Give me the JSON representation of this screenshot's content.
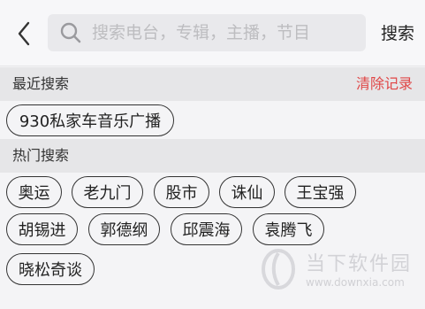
{
  "search": {
    "placeholder": "搜索电台，专辑，主播，节目",
    "value": "",
    "button_label": "搜索"
  },
  "recent": {
    "title": "最近搜索",
    "clear_label": "清除记录",
    "items": [
      "930私家车音乐广播"
    ]
  },
  "hot": {
    "title": "热门搜索",
    "items": [
      "奥运",
      "老九门",
      "股市",
      "诛仙",
      "王宝强",
      "胡锡进",
      "郭德纲",
      "邱震海",
      "袁腾飞",
      "晓松奇谈"
    ]
  },
  "watermark": {
    "title": "当下软件园",
    "url": "www.downxia.com"
  },
  "colors": {
    "accent": "#e04646",
    "section_bg": "#e6e6e8",
    "page_bg": "#f4f4f6"
  },
  "icons": {
    "back": "chevron-left-icon",
    "search": "search-icon"
  }
}
